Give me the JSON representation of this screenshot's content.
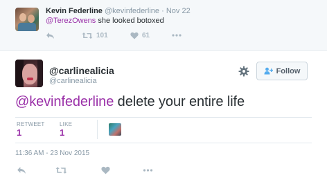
{
  "previous_tweet": {
    "author_name": "Kevin Federline",
    "author_handle": "@kevinfederline",
    "separator": "·",
    "date": "Nov 22",
    "mention": "@TerezOwens",
    "text": " she looked botoxed",
    "retweet_count": "101",
    "like_count": "61"
  },
  "main_tweet": {
    "author_name": "@carlinealicia",
    "author_handle": "@carlinealicia",
    "follow_label": "Follow",
    "mention": "@kevinfederline",
    "text": " delete your entire life",
    "stats": {
      "retweet_label": "RETWEET",
      "retweet_count": "1",
      "like_label": "LIKE",
      "like_count": "1"
    },
    "timestamp": "11:36 AM - 23 Nov 2015"
  },
  "colors": {
    "mention": "#9a30a8",
    "muted": "#8899a6",
    "icon": "#aab8c2",
    "background_top": "#f5f8fa"
  },
  "icons": [
    "reply-icon",
    "retweet-icon",
    "heart-icon",
    "more-icon",
    "gear-icon",
    "follow-person-icon"
  ]
}
